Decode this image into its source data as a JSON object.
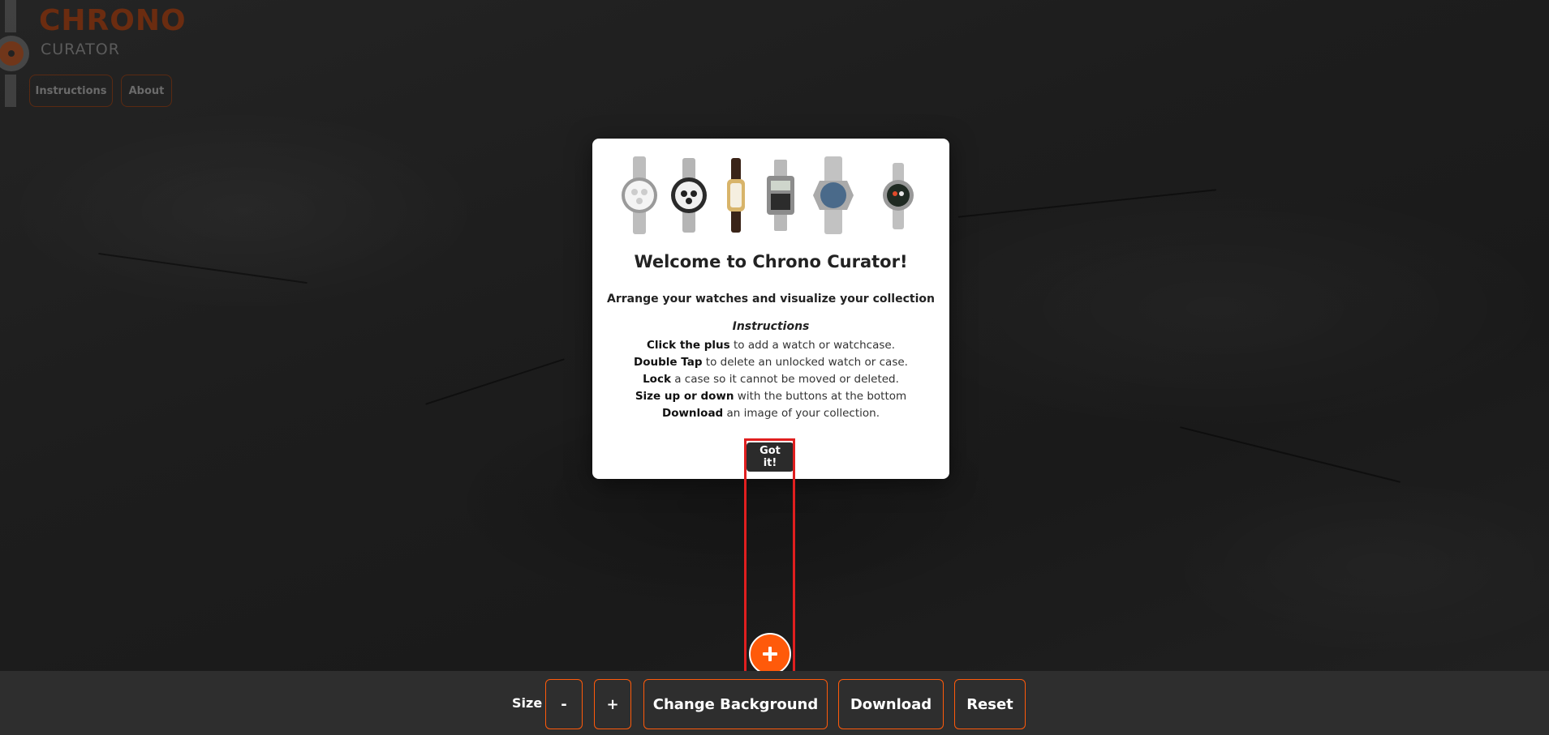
{
  "header": {
    "title": "CHRONO",
    "subtitle": "CURATOR",
    "nav": [
      {
        "label": "Instructions"
      },
      {
        "label": "About"
      }
    ]
  },
  "modal": {
    "title": "Welcome to Chrono Curator!",
    "subtitle": "Arrange your watches and visualize your collection",
    "instructions_heading": "Instructions",
    "instructions": [
      {
        "bold": "Click the plus",
        "text": " to add a watch or watchcase."
      },
      {
        "bold": "Double Tap",
        "text": " to delete an unlocked watch or case."
      },
      {
        "bold": "Lock",
        "text": " a case so it cannot be moved or deleted."
      },
      {
        "bold": "Size up or down",
        "text": " with the buttons at the bottom"
      },
      {
        "bold": "Download",
        "text": " an image of your collection."
      }
    ],
    "confirm_label": "Got it!"
  },
  "fab": {
    "icon": "plus-icon",
    "label": "+"
  },
  "toolbar": {
    "size_label": "Size",
    "decrease_label": "-",
    "increase_label": "+",
    "change_background_label": "Change Background",
    "download_label": "Download",
    "reset_label": "Reset"
  },
  "colors": {
    "accent": "#ff5a0a",
    "toolbar_bg": "#2e2e2e",
    "highlight": "#e01f1f",
    "modal_bg": "#ffffff"
  }
}
